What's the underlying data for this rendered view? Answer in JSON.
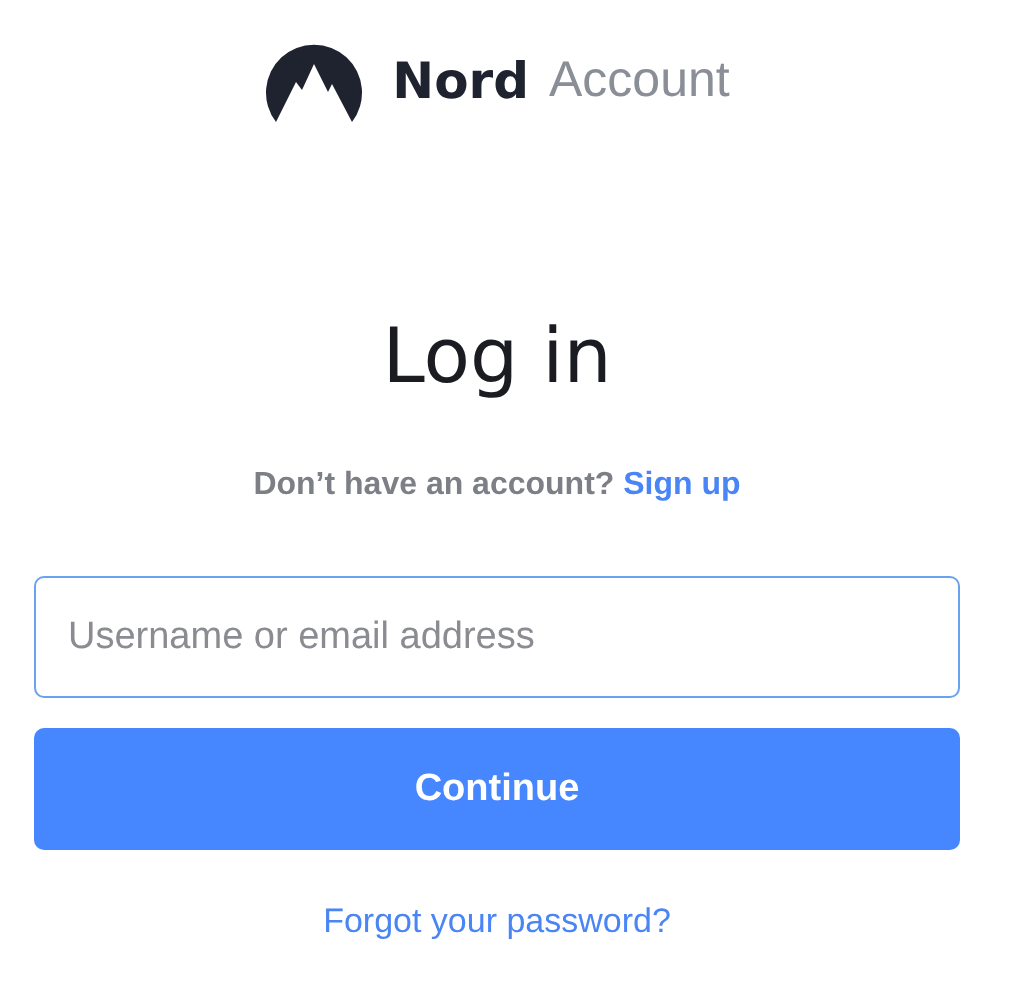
{
  "brand": {
    "name": "Nord",
    "product": "Account"
  },
  "title": "Log in",
  "signup_prompt": {
    "text": "Don’t have an account?",
    "link": "Sign up"
  },
  "username_field": {
    "placeholder": "Username or email address"
  },
  "continue_button": {
    "label": "Continue"
  },
  "forgot_link": "Forgot your password?"
}
